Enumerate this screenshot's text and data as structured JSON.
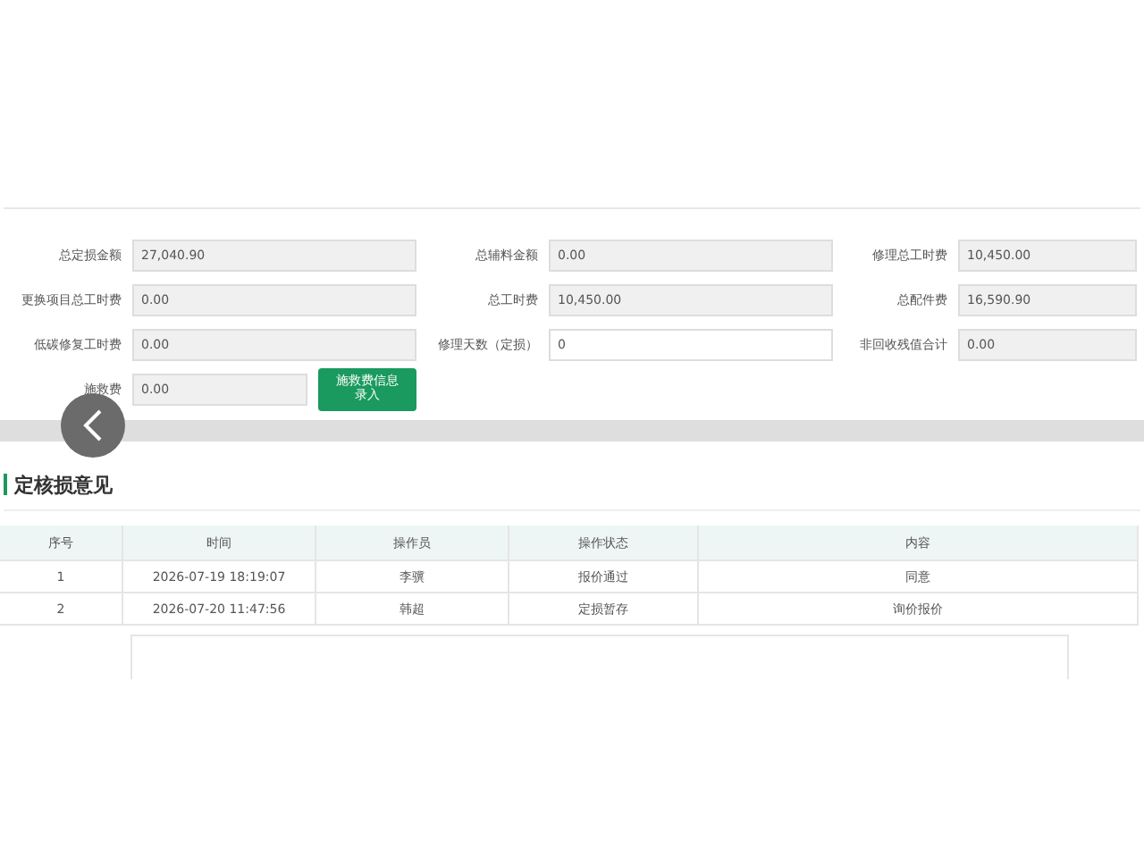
{
  "form": {
    "rows": [
      [
        {
          "label": "总定损金额",
          "value": "27,040.90",
          "editable": false
        },
        {
          "label": "总辅料金额",
          "value": "0.00",
          "editable": false
        },
        {
          "label": "修理总工时费",
          "value": "10,450.00",
          "editable": false
        }
      ],
      [
        {
          "label": "更换项目总工时费",
          "value": "0.00",
          "editable": false
        },
        {
          "label": "总工时费",
          "value": "10,450.00",
          "editable": false
        },
        {
          "label": "总配件费",
          "value": "16,590.90",
          "editable": false
        }
      ],
      [
        {
          "label": "低碳修复工时费",
          "value": "0.00",
          "editable": false
        },
        {
          "label": "修理天数（定损）",
          "value": "0",
          "editable": true
        },
        {
          "label": "非回收残值合计",
          "value": "0.00",
          "editable": false
        }
      ]
    ],
    "rescue": {
      "label": "施救费",
      "value": "0.00",
      "button": [
        "施救费信息",
        "录入"
      ]
    }
  },
  "back_button": true,
  "opinion": {
    "title": "定核损意见",
    "columns": [
      "序号",
      "时间",
      "操作员",
      "操作状态",
      "内容"
    ],
    "rows": [
      [
        "1",
        "2026-07-19 18:19:07",
        "李骥",
        "报价通过",
        "同意"
      ],
      [
        "2",
        "2026-07-20 11:47:56",
        "韩超",
        "定损暂存",
        "询价报价"
      ]
    ]
  }
}
